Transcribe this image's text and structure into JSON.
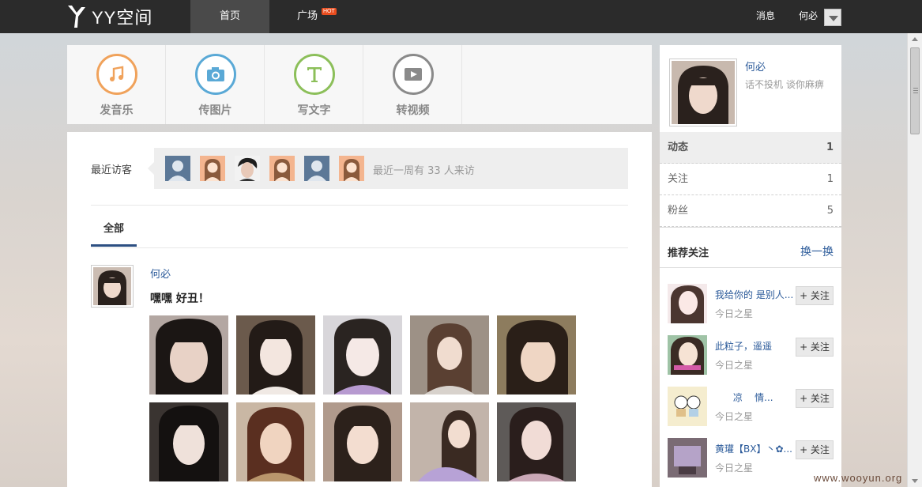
{
  "topbar": {
    "logo_text": "YY空间",
    "nav": [
      {
        "label": "首页",
        "active": true
      },
      {
        "label": "广场",
        "badge": "HOT"
      }
    ],
    "messages_label": "消息",
    "user_name": "何必"
  },
  "publish": {
    "items": [
      {
        "label": "发音乐",
        "icon": "music-note-icon",
        "color": "#f0a25b"
      },
      {
        "label": "传图片",
        "icon": "camera-icon",
        "color": "#5aa9d6"
      },
      {
        "label": "写文字",
        "icon": "text-t-icon",
        "color": "#8cbf5a"
      },
      {
        "label": "转视频",
        "icon": "video-play-icon",
        "color": "#8a8a8a"
      }
    ]
  },
  "visitors": {
    "label": "最近访客",
    "summary": "最近一周有 33 人来访"
  },
  "feed": {
    "tabs": [
      {
        "label": "全部",
        "active": true
      }
    ],
    "post": {
      "author": "何必",
      "text": "嘿嘿 好丑！"
    }
  },
  "profile": {
    "name": "何必",
    "signature": "话不投机 谈你麻痹",
    "stats": [
      {
        "label": "动态",
        "value": "1"
      },
      {
        "label": "关注",
        "value": "1"
      },
      {
        "label": "粉丝",
        "value": "5"
      }
    ]
  },
  "recommend": {
    "title": "推荐关注",
    "change_label": "换一换",
    "follow_label": "+ 关注",
    "items": [
      {
        "name": "我给你的 是别人...",
        "sub": "今日之星"
      },
      {
        "name": "此粒子，遥遥",
        "sub": "今日之星"
      },
      {
        "name": "      凉    情...",
        "sub": "今日之星"
      },
      {
        "name": "黄瓘【BX】丶✿...",
        "sub": "今日之星"
      }
    ]
  },
  "watermark": "www.wooyun.org",
  "colors": {
    "topbar": "#2b2b2b",
    "link": "#2c5b9a",
    "tab_active": "#2c4f82"
  }
}
